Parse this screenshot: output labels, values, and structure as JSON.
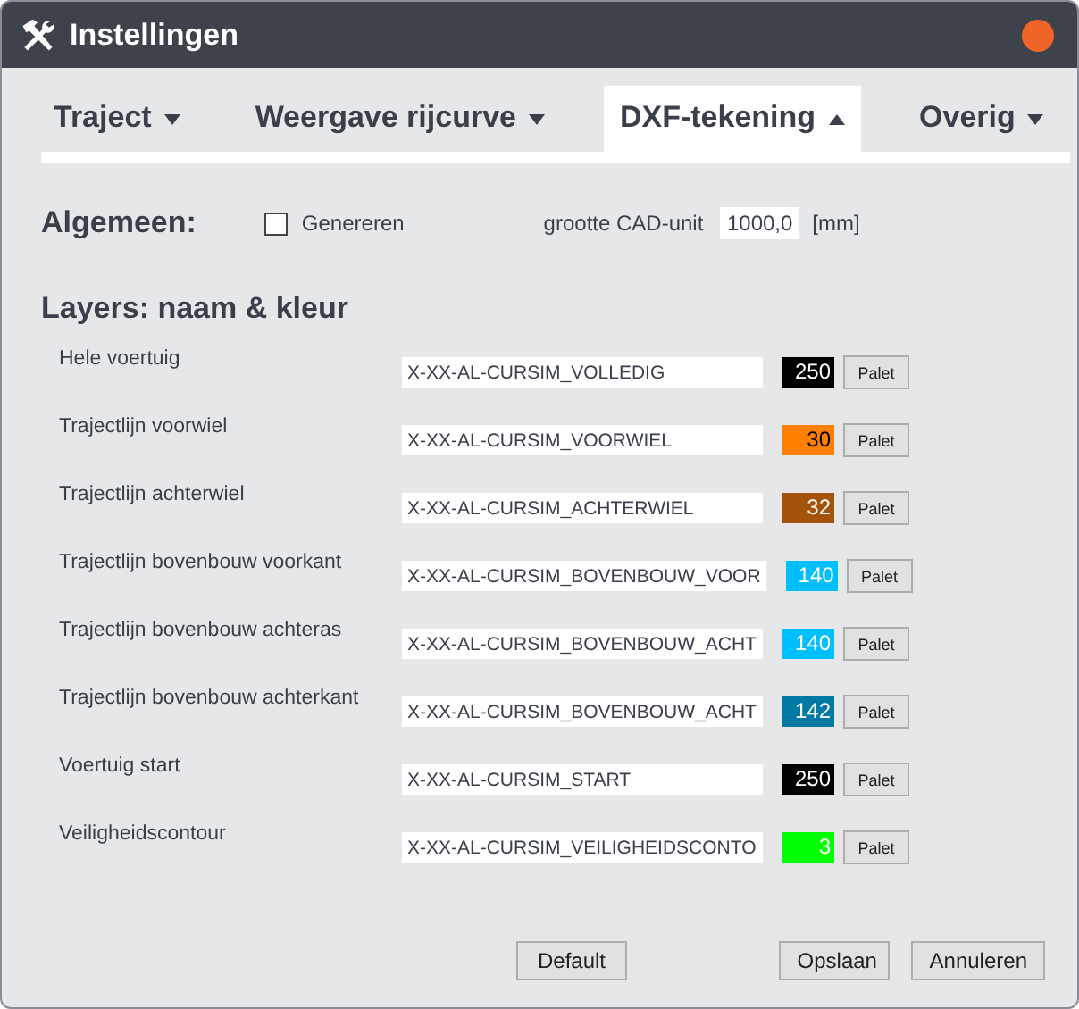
{
  "window": {
    "title": "Instellingen"
  },
  "tabs": [
    {
      "label": "Traject",
      "selected": false
    },
    {
      "label": "Weergave rijcurve",
      "selected": false
    },
    {
      "label": "DXF-tekening",
      "selected": true
    },
    {
      "label": "Overig",
      "selected": false
    }
  ],
  "general": {
    "heading": "Algemeen:",
    "generate": {
      "label": "Genereren",
      "checked": false
    },
    "cad_unit": {
      "label": "grootte CAD-unit",
      "value": "1000,0",
      "unit": "[mm]"
    }
  },
  "layers": {
    "heading": "Layers: naam & kleur",
    "rows": [
      {
        "label": "Hele voertuig",
        "value": "X-XX-AL-CURSIM_VOLLEDIG",
        "color_index": "250",
        "color": "#000000",
        "palette_button": "Palet"
      },
      {
        "label": "Trajectlijn voorwiel",
        "value": "X-XX-AL-CURSIM_VOORWIEL",
        "color_index": "30",
        "color": "#ff7f00",
        "palette_button": "Palet"
      },
      {
        "label": "Trajectlijn achterwiel",
        "value": "X-XX-AL-CURSIM_ACHTERWIEL",
        "color_index": "32",
        "color": "#a5520a",
        "palette_button": "Palet"
      },
      {
        "label": "Trajectlijn bovenbouw voorkant",
        "value": "X-XX-AL-CURSIM_BOVENBOUW_VOOR",
        "color_index": "140",
        "color": "#00bfff",
        "palette_button": "Palet"
      },
      {
        "label": "Trajectlijn bovenbouw achteras",
        "value": "X-XX-AL-CURSIM_BOVENBOUW_ACHT",
        "color_index": "140",
        "color": "#00bfff",
        "palette_button": "Palet"
      },
      {
        "label": "Trajectlijn bovenbouw achterkant",
        "value": "X-XX-AL-CURSIM_BOVENBOUW_ACHT",
        "color_index": "142",
        "color": "#007aa5",
        "palette_button": "Palet"
      },
      {
        "label": "Voertuig start",
        "value": "X-XX-AL-CURSIM_START",
        "color_index": "250",
        "color": "#000000",
        "palette_button": "Palet"
      },
      {
        "label": "Veiligheidscontour",
        "value": "X-XX-AL-CURSIM_VEILIGHEIDSCONTO",
        "color_index": "3",
        "color": "#00ff00",
        "palette_button": "Palet"
      }
    ]
  },
  "buttons": {
    "default": "Default",
    "save": "Opslaan",
    "cancel": "Annuleren"
  }
}
